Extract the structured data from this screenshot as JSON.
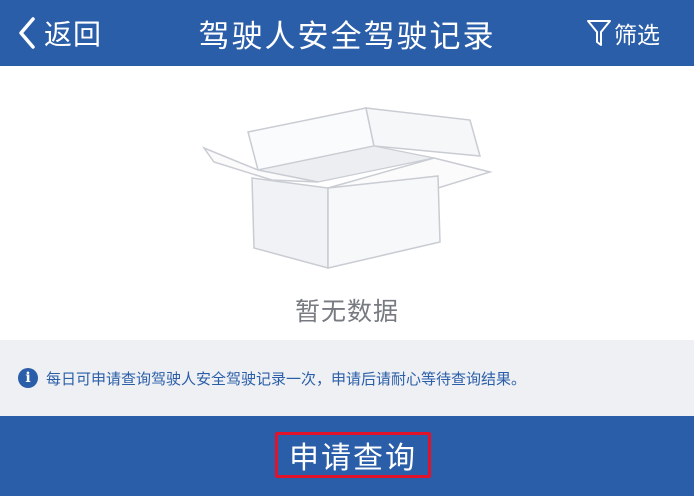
{
  "header": {
    "back_label": "返回",
    "back_icon": "chevron-left-icon",
    "title": "驾驶人安全驾驶记录",
    "filter_label": "筛选",
    "filter_icon": "funnel-icon",
    "background_color": "#2b5ea8"
  },
  "empty_state": {
    "icon": "empty-box-icon",
    "text": "暂无数据"
  },
  "notice": {
    "icon": "info-icon",
    "icon_glyph": "i",
    "text": "每日可申请查询驾驶人安全驾驶记录一次，申请后请耐心等待查询结果。",
    "color": "#2b5ea8"
  },
  "footer": {
    "apply_label": "申请查询",
    "highlight_color": "#e0132a"
  }
}
